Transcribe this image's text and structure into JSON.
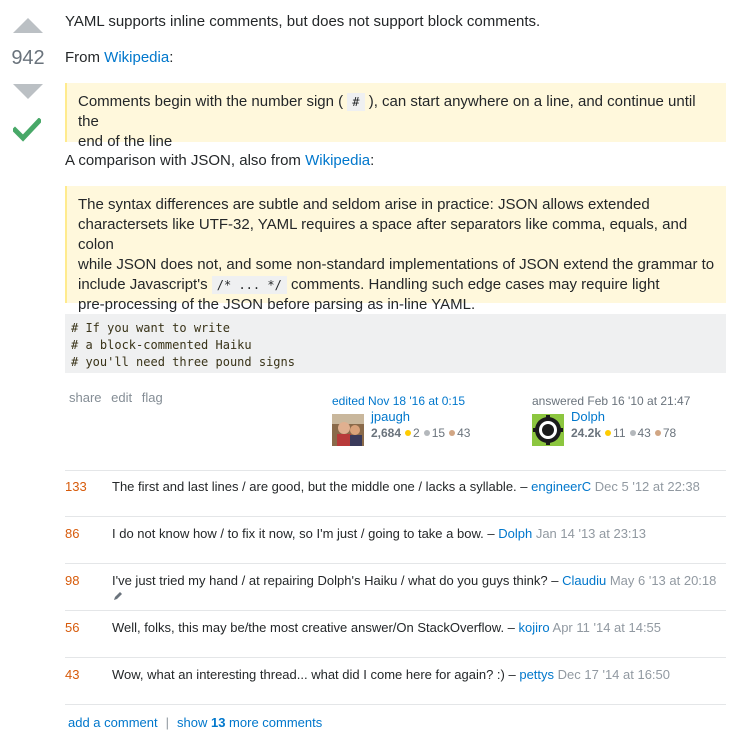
{
  "vote": {
    "count": "942"
  },
  "post": {
    "p1": "YAML supports inline comments, but does not support block comments.",
    "p2_prefix": "From ",
    "p2_link": "Wikipedia",
    "p2_suffix": ":",
    "quote1_before": "Comments begin with the number sign (",
    "quote1_code": "#",
    "quote1_after": "), can start anywhere on a line, and continue until the",
    "quote1_line2": "end of the line",
    "p3_prefix": "A comparison with JSON, also from ",
    "p3_link": "Wikipedia",
    "p3_suffix": ":",
    "quote2_l1": "The syntax differences are subtle and seldom arise in practice: JSON allows extended",
    "quote2_l2": "charactersets like UTF-32, YAML requires a space after separators like comma, equals, and colon",
    "quote2_l3": "while JSON does not, and some non-standard implementations of JSON extend the grammar to",
    "quote2_l4_before": "include Javascript's ",
    "quote2_l4_code": "/* ... */",
    "quote2_l4_after": " comments. Handling such edge cases may require light",
    "quote2_l5": "pre-processing of the JSON before parsing as in-line YAML.",
    "code_l1": "# If you want to write",
    "code_l2": "# a block-commented Haiku",
    "code_l3": "# you'll need three pound signs"
  },
  "post_menu": {
    "share": "share",
    "edit": "edit",
    "flag": "flag"
  },
  "edited": {
    "action": "edited Nov 18 '16 at 0:15",
    "user": "jpaugh",
    "rep": "2,684",
    "gold": "2",
    "silver": "15",
    "bronze": "43"
  },
  "answered": {
    "action": "answered Feb 16 '10 at 21:47",
    "user": "Dolph",
    "rep": "24.2k",
    "gold": "11",
    "silver": "43",
    "bronze": "78"
  },
  "comments": [
    {
      "score": "133",
      "text": "The first and last lines / are good, but the middle one / lacks a syllable. –",
      "user": "engineerC",
      "date": "Dec 5 '12 at 22:38"
    },
    {
      "score": "86",
      "text": "I do not know how / to fix it now, so I'm just / going to take a bow. –",
      "user": "Dolph",
      "date": "Jan 14 '13 at 23:13"
    },
    {
      "score": "98",
      "text": "I've just tried my hand / at repairing Dolph's Haiku / what do you guys think? –",
      "user": "Claudiu",
      "date": "May 6 '13 at 20:18"
    },
    {
      "score": "56",
      "text": "Well, folks, this may be/the most creative answer/On StackOverflow. –",
      "user": "kojiro",
      "date": "Apr 11 '14 at 14:55"
    },
    {
      "score": "43",
      "text": "Wow, what an interesting thread... what did I come here for again? :) –",
      "user": "pettys",
      "date": "Dec 17 '14 at 16:50"
    }
  ],
  "footer": {
    "add_comment": "add a comment",
    "sep": "|",
    "show_prefix": "show ",
    "show_count": "13",
    "show_suffix": " more comments"
  },
  "colors": {
    "accent": "#0077cc",
    "score": "#d75b0b",
    "accepted": "#48a868",
    "quote_bg": "#fff8dc"
  },
  "icons": {
    "upvote": "up-arrow",
    "downvote": "down-arrow",
    "accepted": "checkmark",
    "edited_comment": "pencil"
  }
}
